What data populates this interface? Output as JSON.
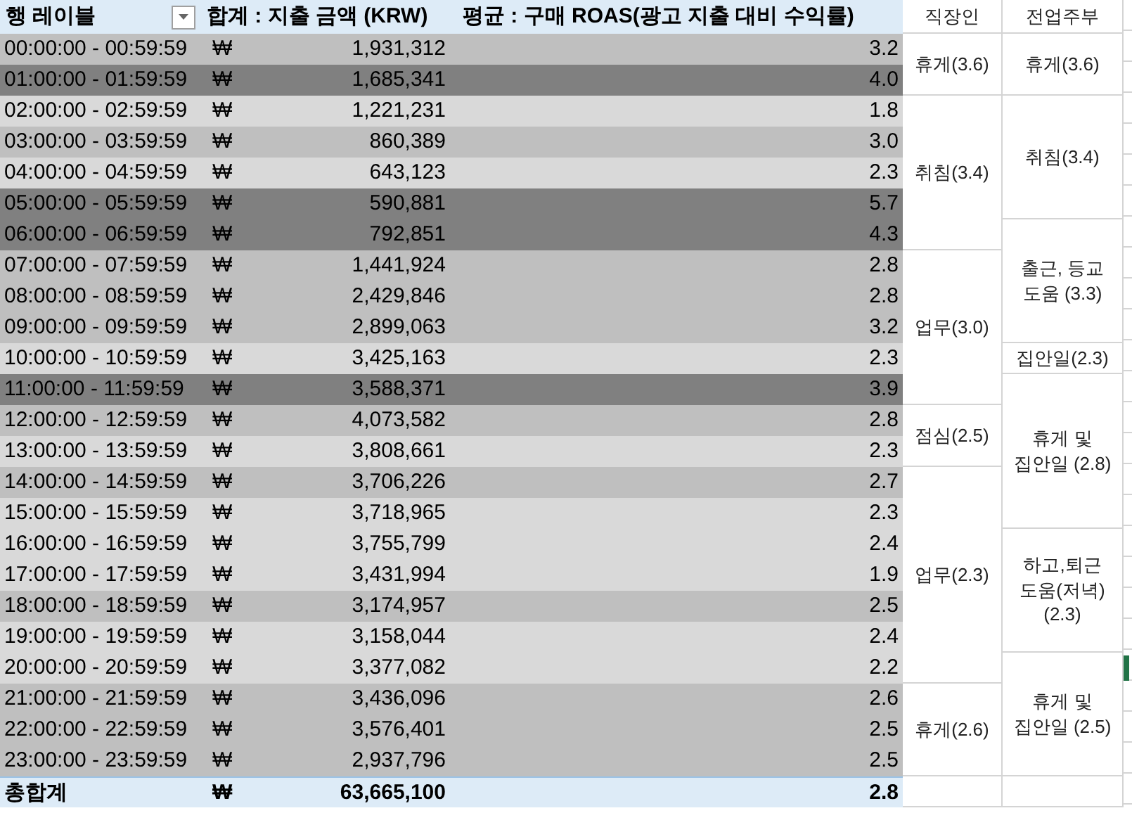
{
  "columns": [
    {
      "label": "행 레이블",
      "filter": true
    },
    {
      "label": "합계 : 지출 금액 (KRW)",
      "filter": false
    },
    {
      "label": "평균 : 구매 ROAS(광고 지출 대비 수익률)",
      "filter": false
    },
    {
      "label": "직장인",
      "filter": false
    },
    {
      "label": "전업주부",
      "filter": false
    }
  ],
  "rows": [
    {
      "label": "00:00:00 - 00:59:59",
      "currency": "₩",
      "amount": "1,931,312",
      "roas": "3.2",
      "color": "#bfbfbf",
      "office_worker": "휴게(3.6)",
      "homemaker": "휴게(3.6)"
    },
    {
      "label": "01:00:00 - 01:59:59",
      "currency": "₩",
      "amount": "1,685,341",
      "roas": "4.0",
      "color": "#808080"
    },
    {
      "label": "02:00:00 - 02:59:59",
      "currency": "₩",
      "amount": "1,221,231",
      "roas": "1.8",
      "color": "#d9d9d9",
      "office_worker": "취침(3.4)",
      "homemaker": "취침(3.4)"
    },
    {
      "label": "03:00:00 - 03:59:59",
      "currency": "₩",
      "amount": "860,389",
      "roas": "3.0",
      "color": "#bfbfbf"
    },
    {
      "label": "04:00:00 - 04:59:59",
      "currency": "₩",
      "amount": "643,123",
      "roas": "2.3",
      "color": "#d9d9d9"
    },
    {
      "label": "05:00:00 - 05:59:59",
      "currency": "₩",
      "amount": "590,881",
      "roas": "5.7",
      "color": "#808080"
    },
    {
      "label": "06:00:00 - 06:59:59",
      "currency": "₩",
      "amount": "792,851",
      "roas": "4.3",
      "color": "#808080",
      "homemaker": "출근, 등교 도움 (3.3)"
    },
    {
      "label": "07:00:00 - 07:59:59",
      "currency": "₩",
      "amount": "1,441,924",
      "roas": "2.8",
      "color": "#bfbfbf",
      "office_worker": "업무(3.0)"
    },
    {
      "label": "08:00:00 - 08:59:59",
      "currency": "₩",
      "amount": "2,429,846",
      "roas": "2.8",
      "color": "#bfbfbf"
    },
    {
      "label": "09:00:00 - 09:59:59",
      "currency": "₩",
      "amount": "2,899,063",
      "roas": "3.2",
      "color": "#bfbfbf"
    },
    {
      "label": "10:00:00 - 10:59:59",
      "currency": "₩",
      "amount": "3,425,163",
      "roas": "2.3",
      "color": "#d9d9d9",
      "homemaker": "집안일(2.3)"
    },
    {
      "label": "11:00:00 - 11:59:59",
      "currency": "₩",
      "amount": "3,588,371",
      "roas": "3.9",
      "color": "#808080",
      "homemaker": "휴게 및 집안일 (2.8)"
    },
    {
      "label": "12:00:00 - 12:59:59",
      "currency": "₩",
      "amount": "4,073,582",
      "roas": "2.8",
      "color": "#bfbfbf",
      "office_worker": "점심(2.5)"
    },
    {
      "label": "13:00:00 - 13:59:59",
      "currency": "₩",
      "amount": "3,808,661",
      "roas": "2.3",
      "color": "#d9d9d9"
    },
    {
      "label": "14:00:00 - 14:59:59",
      "currency": "₩",
      "amount": "3,706,226",
      "roas": "2.7",
      "color": "#bfbfbf",
      "office_worker": "업무(2.3)"
    },
    {
      "label": "15:00:00 - 15:59:59",
      "currency": "₩",
      "amount": "3,718,965",
      "roas": "2.3",
      "color": "#d9d9d9"
    },
    {
      "label": "16:00:00 - 16:59:59",
      "currency": "₩",
      "amount": "3,755,799",
      "roas": "2.4",
      "color": "#d9d9d9",
      "homemaker": "하고,퇴근 도움(저녁) (2.3)"
    },
    {
      "label": "17:00:00 - 17:59:59",
      "currency": "₩",
      "amount": "3,431,994",
      "roas": "1.9",
      "color": "#d9d9d9"
    },
    {
      "label": "18:00:00 - 18:59:59",
      "currency": "₩",
      "amount": "3,174,957",
      "roas": "2.5",
      "color": "#bfbfbf"
    },
    {
      "label": "19:00:00 - 19:59:59",
      "currency": "₩",
      "amount": "3,158,044",
      "roas": "2.4",
      "color": "#d9d9d9"
    },
    {
      "label": "20:00:00 - 20:59:59",
      "currency": "₩",
      "amount": "3,377,082",
      "roas": "2.2",
      "color": "#d9d9d9",
      "homemaker": "휴게 및 집안일 (2.5)"
    },
    {
      "label": "21:00:00 - 21:59:59",
      "currency": "₩",
      "amount": "3,436,096",
      "roas": "2.6",
      "color": "#bfbfbf",
      "office_worker": "휴게(2.6)"
    },
    {
      "label": "22:00:00 - 22:59:59",
      "currency": "₩",
      "amount": "3,576,401",
      "roas": "2.5",
      "color": "#bfbfbf"
    },
    {
      "label": "23:00:00 - 23:59:59",
      "currency": "₩",
      "amount": "2,937,796",
      "roas": "2.5",
      "color": "#bfbfbf"
    }
  ],
  "total": {
    "label": "총합계",
    "currency": "₩",
    "amount": "63,665,100",
    "roas": "2.8"
  }
}
